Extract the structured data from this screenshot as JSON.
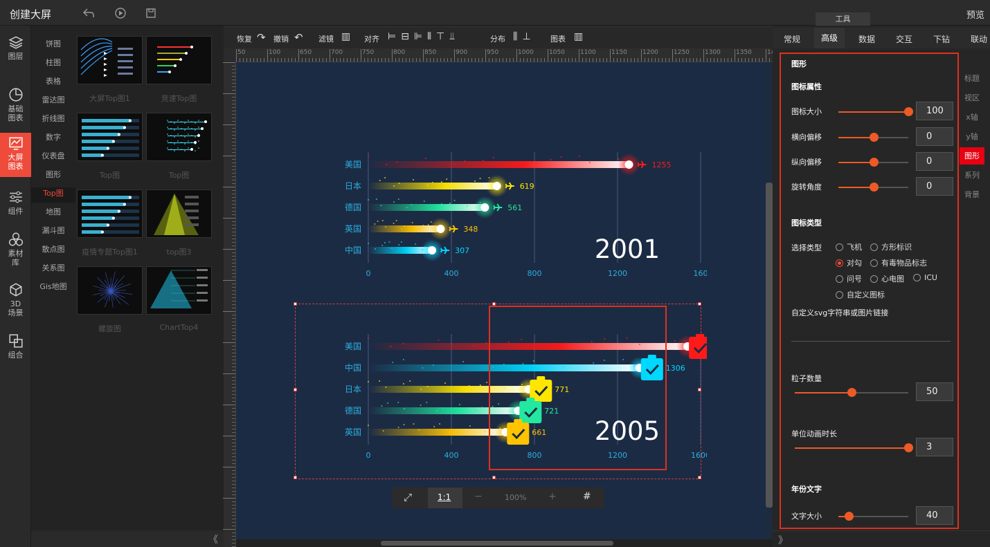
{
  "header": {
    "title": "创建大屏",
    "preview": "预览",
    "tools_tab": "工具"
  },
  "leftnav": [
    {
      "label": "图层",
      "icon": "layers-icon"
    },
    {
      "label": "基础\n图表",
      "icon": "pie-icon"
    },
    {
      "label": "大屏\n图表",
      "icon": "screen-chart-icon",
      "active": true
    },
    {
      "label": "组件",
      "icon": "sliders-icon"
    },
    {
      "label": "素材\n库",
      "icon": "circles-icon"
    },
    {
      "label": "3D\n场景",
      "icon": "cube-icon"
    },
    {
      "label": "组合",
      "icon": "group-icon"
    }
  ],
  "categories": [
    "饼图",
    "柱图",
    "表格",
    "雷达图",
    "折线图",
    "数字",
    "仪表盘",
    "图形",
    "Top图",
    "地图",
    "漏斗图",
    "散点图",
    "关系图",
    "Gis地图"
  ],
  "active_category": "Top图",
  "thumbnails": [
    "大屏Top图1",
    "竞速Top图",
    "Top图",
    "Top图",
    "疫情专题Top图1",
    "top图3",
    "螺旋图",
    "ChartTop4"
  ],
  "toolbar": {
    "redo": "恢复",
    "undo": "撤销",
    "filter": "滤镜",
    "align": "对齐",
    "distribute": "分布",
    "chart": "图表"
  },
  "ruler_top": [
    "50",
    "100",
    "650",
    "700",
    "750",
    "800",
    "850",
    "900",
    "950",
    "1000",
    "1050",
    "1100",
    "1150",
    "1200",
    "1250",
    "1300",
    "1350",
    "1400"
  ],
  "zoom": {
    "fit": "⤢",
    "one": "1:1",
    "minus": "−",
    "level": "100%",
    "plus": "+",
    "grid": "#"
  },
  "right_tabs": [
    "常规",
    "高级",
    "数据",
    "交互",
    "下钻",
    "联动"
  ],
  "active_right_tab": "高级",
  "side_tabs": [
    "标题",
    "视区",
    "x轴",
    "y轴",
    "图形",
    "系列",
    "背景"
  ],
  "active_side_tab": "图形",
  "panel": {
    "section": "图形",
    "icon_props": "图标属性",
    "size_label": "图标大小",
    "size": "100",
    "size_frac": 1.0,
    "hoff_label": "横向偏移",
    "hoff": "0",
    "hoff_frac": 0.5,
    "voff_label": "纵向偏移",
    "voff": "0",
    "voff_frac": 0.5,
    "rot_label": "旋转角度",
    "rot": "0",
    "rot_frac": 0.5,
    "icon_type": "图标类型",
    "select_type": "选择类型",
    "options": [
      "飞机",
      "方形标识",
      "对勾",
      "有毒物品标志",
      "问号",
      "心电图",
      "ICU",
      "自定义图标"
    ],
    "selected": "对勾",
    "custom_svg": "自定义svg字符串或图片链接",
    "particle_label": "粒子数量",
    "particle": "50",
    "particle_frac": 0.5,
    "anim_label": "单位动画时长",
    "anim": "3",
    "anim_frac": 1.0,
    "year_text": "年份文字",
    "font_label": "文字大小",
    "font": "40",
    "font_frac": 0.15
  },
  "chart_data": [
    {
      "type": "bar",
      "year": "2001",
      "categories": [
        "美国",
        "日本",
        "德国",
        "英国",
        "中国"
      ],
      "values": [
        1255,
        619,
        561,
        348,
        307
      ],
      "xticks": [
        "0",
        "400",
        "800",
        "1200",
        "160"
      ],
      "xlim": [
        0,
        1600
      ],
      "colors": [
        "#ff1a1a",
        "#ffe600",
        "#22e8a0",
        "#ffc400",
        "#00d8ff"
      ],
      "icon": "plane-icon"
    },
    {
      "type": "bar",
      "year": "2005",
      "categories": [
        "美国",
        "中国",
        "日本",
        "德国",
        "英国"
      ],
      "values": [
        1537,
        1306,
        771,
        721,
        661
      ],
      "xticks": [
        "0",
        "400",
        "800",
        "1200",
        "1600"
      ],
      "xlim": [
        0,
        1600
      ],
      "colors": [
        "#ff1a1a",
        "#00d8ff",
        "#ffe600",
        "#22e8a0",
        "#ffc400"
      ],
      "icon": "check-clipboard-icon"
    }
  ]
}
